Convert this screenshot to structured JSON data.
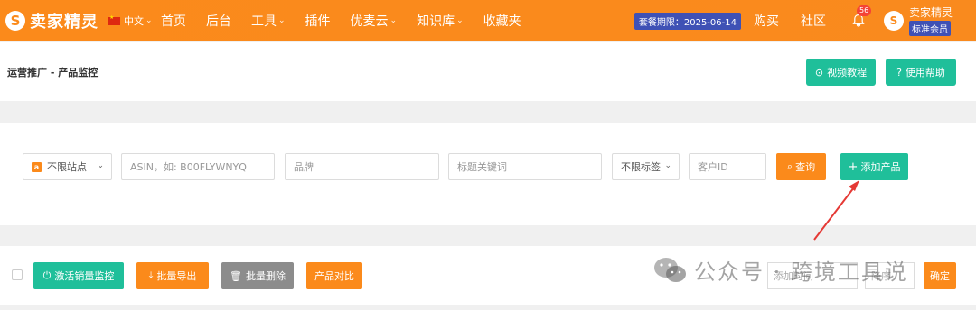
{
  "topbar": {
    "logo_text": "卖家精灵",
    "lang": "中文",
    "nav": [
      "首页",
      "后台",
      "工具",
      "插件",
      "优麦云",
      "知识库",
      "收藏夹"
    ],
    "nav_dropdowns": [
      false,
      false,
      true,
      false,
      true,
      true,
      false
    ],
    "expiry": "套餐期限：2025-06-14",
    "buy": "购买",
    "community": "社区",
    "bell_count": "56",
    "user_name": "卖家精灵",
    "user_level": "标准会员"
  },
  "header": {
    "breadcrumb": "运营推广 - 产品监控",
    "video_label": "视频教程",
    "help_label": "使用帮助"
  },
  "filters": {
    "site": "不限站点",
    "asin_placeholder": "ASIN，如: B00FLYWNYQ",
    "brand_placeholder": "品牌",
    "title_placeholder": "标题关键词",
    "tag": "不限标签",
    "customer_placeholder": "客户ID",
    "query_label": "查询",
    "add_label": "添加产品"
  },
  "actions": {
    "activate_label": "激活销量监控",
    "export_label": "批量导出",
    "delete_label": "批量删除",
    "compare_label": "产品对比",
    "time_placeholder": "添加时间",
    "sort_placeholder": "降序",
    "confirm_label": "确定"
  },
  "watermark": {
    "text": "公众号 · 跨境工具说"
  },
  "colors": {
    "brand": "#fb8a1b",
    "teal": "#1fbf9a",
    "badge": "#3f51b5",
    "arrow": "#e53935"
  }
}
